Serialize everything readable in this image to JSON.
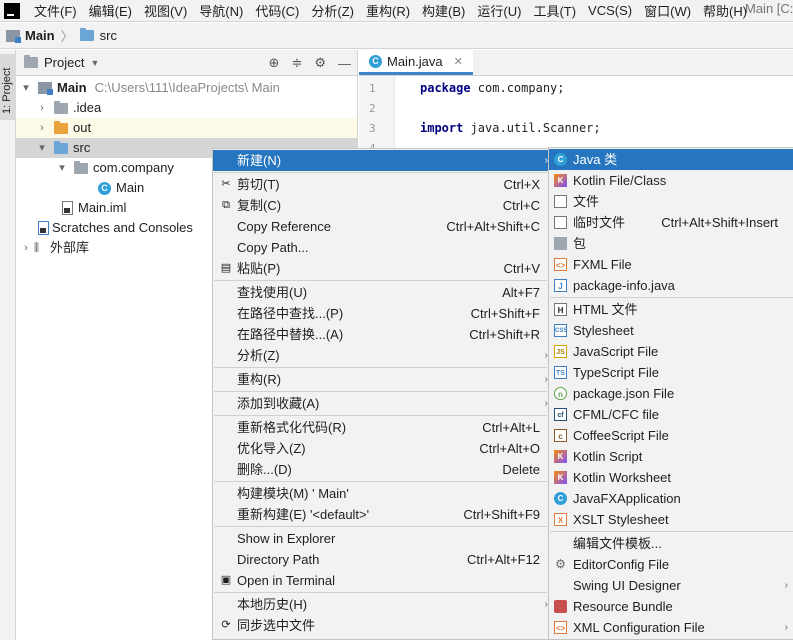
{
  "colors": {
    "accent": "#2675bf",
    "selection": "#d5d5d5",
    "highlight_row": "#fdfae8",
    "menu_bg": "#f2f2f2"
  },
  "menubar": {
    "items": [
      "文件(F)",
      "编辑(E)",
      "视图(V)",
      "导航(N)",
      "代码(C)",
      "分析(Z)",
      "重构(R)",
      "构建(B)",
      "运行(U)",
      "工具(T)",
      "VCS(S)",
      "窗口(W)",
      "帮助(H)"
    ],
    "window_title": "Main [C:"
  },
  "navbar": {
    "project": "Main",
    "folder": "src"
  },
  "stripe": {
    "tab_label": "1: Project"
  },
  "project_panel": {
    "title": "Project",
    "tree": [
      {
        "label": "Main",
        "path": "C:\\Users\\111\\IdeaProjects\\ Main",
        "icon": "module-folder-icon",
        "arrow": "▾"
      },
      {
        "label": ".idea",
        "icon": "folder-icon",
        "arrow": "›"
      },
      {
        "label": "out",
        "icon": "folder-orange-icon",
        "arrow": "›"
      },
      {
        "label": "src",
        "icon": "folder-blue-icon",
        "arrow": "▾"
      },
      {
        "label": "com.company",
        "icon": "package-icon",
        "arrow": "▾"
      },
      {
        "label": "Main",
        "icon": "class-icon",
        "arrow": ""
      },
      {
        "label": "Main.iml",
        "icon": "iml-file-icon",
        "arrow": ""
      },
      {
        "label": "Scratches and Consoles",
        "icon": "scratches-icon",
        "arrow": ""
      },
      {
        "label": "外部库",
        "icon": "libraries-icon",
        "arrow": "›"
      }
    ]
  },
  "editor": {
    "tab_label": "Main.java",
    "lines": [
      {
        "num": "1",
        "kw": "package",
        "rest": " com.company;"
      },
      {
        "num": "2",
        "kw": "",
        "rest": ""
      },
      {
        "num": "3",
        "kw": "import",
        "rest": " java.util.Scanner;"
      },
      {
        "num": "4",
        "kw": "",
        "rest": ""
      }
    ]
  },
  "context_menu": {
    "items": [
      {
        "label": "新建(N)",
        "shortcut": "",
        "submenu": true,
        "icon": ""
      },
      {
        "label": "剪切(T)",
        "shortcut": "Ctrl+X",
        "icon": "cut-icon"
      },
      {
        "label": "复制(C)",
        "shortcut": "Ctrl+C",
        "icon": "copy-icon"
      },
      {
        "label": "Copy Reference",
        "shortcut": "Ctrl+Alt+Shift+C",
        "icon": ""
      },
      {
        "label": "Copy Path...",
        "shortcut": "",
        "icon": ""
      },
      {
        "label": "粘贴(P)",
        "shortcut": "Ctrl+V",
        "icon": "paste-icon"
      },
      {
        "label": "查找使用(U)",
        "shortcut": "Alt+F7",
        "icon": ""
      },
      {
        "label": "在路径中查找...(P)",
        "shortcut": "Ctrl+Shift+F",
        "icon": ""
      },
      {
        "label": "在路径中替换...(A)",
        "shortcut": "Ctrl+Shift+R",
        "icon": ""
      },
      {
        "label": "分析(Z)",
        "shortcut": "",
        "submenu": true,
        "icon": ""
      },
      {
        "label": "重构(R)",
        "shortcut": "",
        "submenu": true,
        "icon": ""
      },
      {
        "label": "添加到收藏(A)",
        "shortcut": "",
        "submenu": true,
        "icon": ""
      },
      {
        "label": "重新格式化代码(R)",
        "shortcut": "Ctrl+Alt+L",
        "icon": ""
      },
      {
        "label": "优化导入(Z)",
        "shortcut": "Ctrl+Alt+O",
        "icon": ""
      },
      {
        "label": "删除...(D)",
        "shortcut": "Delete",
        "icon": ""
      },
      {
        "label": "构建模块(M) ' Main'",
        "shortcut": "",
        "icon": ""
      },
      {
        "label": "重新构建(E) '<default>'",
        "shortcut": "Ctrl+Shift+F9",
        "icon": ""
      },
      {
        "label": "Show in Explorer",
        "shortcut": "",
        "icon": ""
      },
      {
        "label": "Directory Path",
        "shortcut": "Ctrl+Alt+F12",
        "icon": ""
      },
      {
        "label": "Open in Terminal",
        "shortcut": "",
        "icon": "terminal-icon"
      },
      {
        "label": "本地历史(H)",
        "shortcut": "",
        "submenu": true,
        "icon": ""
      },
      {
        "label": "同步选中文件",
        "shortcut": "",
        "icon": "sync-icon"
      }
    ]
  },
  "new_submenu": {
    "items": [
      {
        "label": "Java 类",
        "shortcut": "",
        "icon": "java-class-icon",
        "glyph": "C"
      },
      {
        "label": "Kotlin File/Class",
        "shortcut": "",
        "icon": "kotlin-icon",
        "glyph": "K"
      },
      {
        "label": "文件",
        "shortcut": "",
        "icon": "file-icon",
        "glyph": ""
      },
      {
        "label": "临时文件",
        "shortcut": "Ctrl+Alt+Shift+Insert",
        "icon": "scratch-file-icon",
        "glyph": ""
      },
      {
        "label": "包",
        "shortcut": "",
        "icon": "package-icon",
        "glyph": ""
      },
      {
        "label": "FXML File",
        "shortcut": "",
        "icon": "fxml-icon",
        "glyph": "<>"
      },
      {
        "label": "package-info.java",
        "shortcut": "",
        "icon": "java-file-icon",
        "glyph": "J"
      },
      {
        "label": "HTML 文件",
        "shortcut": "",
        "icon": "html-icon",
        "glyph": "H"
      },
      {
        "label": "Stylesheet",
        "shortcut": "",
        "icon": "css-icon",
        "glyph": "CSS"
      },
      {
        "label": "JavaScript File",
        "shortcut": "",
        "icon": "js-icon",
        "glyph": "JS"
      },
      {
        "label": "TypeScript File",
        "shortcut": "",
        "icon": "ts-icon",
        "glyph": "TS"
      },
      {
        "label": "package.json File",
        "shortcut": "",
        "icon": "npm-icon",
        "glyph": "n"
      },
      {
        "label": "CFML/CFC file",
        "shortcut": "",
        "icon": "cfml-icon",
        "glyph": "cf"
      },
      {
        "label": "CoffeeScript File",
        "shortcut": "",
        "icon": "coffee-icon",
        "glyph": "c"
      },
      {
        "label": "Kotlin Script",
        "shortcut": "",
        "icon": "kotlin-script-icon",
        "glyph": "K"
      },
      {
        "label": "Kotlin Worksheet",
        "shortcut": "",
        "icon": "kotlin-worksheet-icon",
        "glyph": "K"
      },
      {
        "label": "JavaFXApplication",
        "shortcut": "",
        "icon": "javafx-icon",
        "glyph": "C"
      },
      {
        "label": "XSLT Stylesheet",
        "shortcut": "",
        "icon": "xslt-icon",
        "glyph": "X"
      },
      {
        "label": "编辑文件模板...",
        "shortcut": "",
        "icon": "",
        "glyph": ""
      },
      {
        "label": "EditorConfig File",
        "shortcut": "",
        "icon": "gear-icon",
        "glyph": "⚙"
      },
      {
        "label": "Swing UI Designer",
        "shortcut": "",
        "icon": "",
        "glyph": "",
        "submenu": true
      },
      {
        "label": "Resource Bundle",
        "shortcut": "",
        "icon": "resource-bundle-icon",
        "glyph": ""
      },
      {
        "label": "XML Configuration File",
        "shortcut": "",
        "icon": "xml-icon",
        "glyph": "<>",
        "submenu": true
      }
    ]
  }
}
